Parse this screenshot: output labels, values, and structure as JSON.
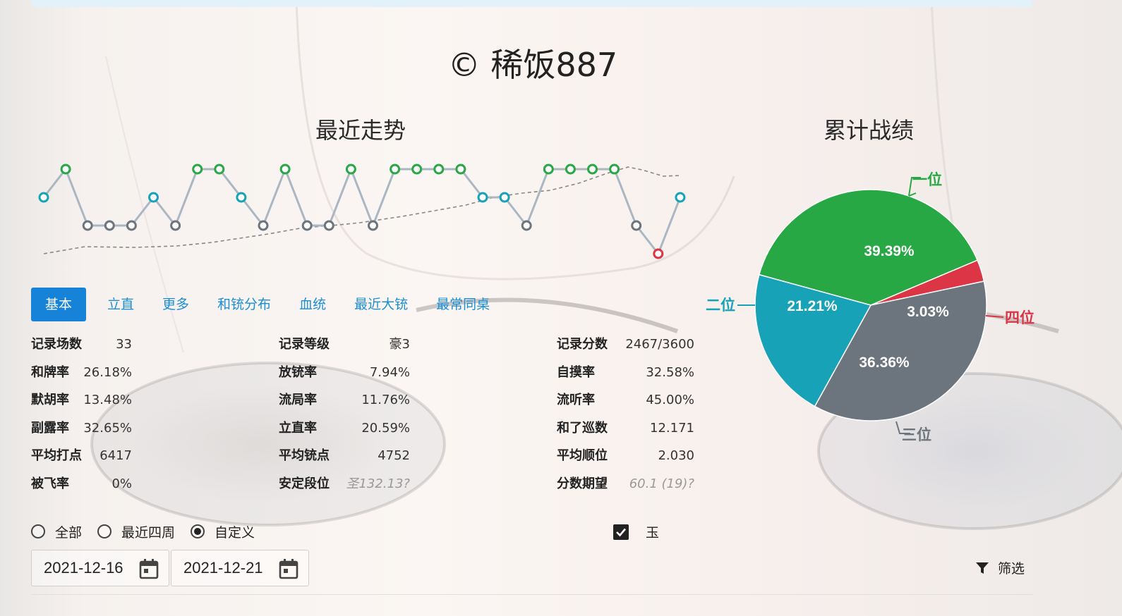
{
  "header": {
    "title": "© 稀饭887"
  },
  "trend": {
    "title": "最近走势",
    "legend_colors": {
      "1": "#28a745",
      "2": "#17a2b8",
      "3": "#6c757d",
      "4": "#dc3545"
    }
  },
  "pie": {
    "title": "累计战绩",
    "slices": [
      {
        "label": "一位",
        "percent": "39.39%",
        "value": 39.39,
        "color": "#28a745"
      },
      {
        "label": "四位",
        "percent": "3.03%",
        "value": 3.03,
        "color": "#dc3545"
      },
      {
        "label": "三位",
        "percent": "36.36%",
        "value": 36.36,
        "color": "#6c757d"
      },
      {
        "label": "二位",
        "percent": "21.21%",
        "value": 21.21,
        "color": "#17a2b8"
      }
    ]
  },
  "tabs": [
    {
      "label": "基本",
      "active": true
    },
    {
      "label": "立直"
    },
    {
      "label": "更多"
    },
    {
      "label": "和铳分布"
    },
    {
      "label": "血统"
    },
    {
      "label": "最近大铳"
    },
    {
      "label": "最常同桌"
    }
  ],
  "stats": {
    "col1": [
      {
        "label": "记录场数",
        "value": "33"
      },
      {
        "label": "和牌率",
        "value": "26.18%"
      },
      {
        "label": "默胡率",
        "value": "13.48%"
      },
      {
        "label": "副露率",
        "value": "32.65%"
      },
      {
        "label": "平均打点",
        "value": "6417"
      },
      {
        "label": "被飞率",
        "value": "0%"
      }
    ],
    "col2": [
      {
        "label": "记录等级",
        "value": "豪3"
      },
      {
        "label": "放铳率",
        "value": "7.94%"
      },
      {
        "label": "流局率",
        "value": "11.76%"
      },
      {
        "label": "立直率",
        "value": "20.59%"
      },
      {
        "label": "平均铳点",
        "value": "4752"
      },
      {
        "label": "安定段位",
        "value": "圣132.13?",
        "muted": true
      }
    ],
    "col3": [
      {
        "label": "记录分数",
        "value": "2467/3600"
      },
      {
        "label": "自摸率",
        "value": "32.58%"
      },
      {
        "label": "流听率",
        "value": "45.00%"
      },
      {
        "label": "和了巡数",
        "value": "12.171"
      },
      {
        "label": "平均顺位",
        "value": "2.030"
      },
      {
        "label": "分数期望",
        "value": "60.1 (19)?",
        "muted": true
      }
    ]
  },
  "filters": {
    "range_options": [
      "全部",
      "最近四周",
      "自定义"
    ],
    "range_selected": "自定义",
    "jade_label": "玉",
    "jade_checked": true,
    "start_date": "2021-12-16",
    "end_date": "2021-12-21",
    "filter_label": "筛选"
  },
  "chart_data": [
    {
      "type": "line",
      "title": "最近走势",
      "x": [
        1,
        2,
        3,
        4,
        5,
        6,
        7,
        8,
        9,
        10,
        11,
        12,
        13,
        14,
        15,
        16,
        17,
        18,
        19,
        20,
        21,
        22,
        23,
        24,
        25,
        26,
        27,
        28,
        29,
        30,
        31
      ],
      "series": [
        {
          "values": [
            2,
            1,
            3,
            3,
            3,
            2,
            3,
            1,
            1,
            2,
            3,
            1,
            3,
            3,
            1,
            3,
            1,
            1,
            1,
            1,
            2,
            2,
            3,
            1,
            1,
            1,
            1,
            3,
            4,
            2
          ]
        }
      ],
      "ylim": [
        1,
        4
      ]
    },
    {
      "type": "pie",
      "title": "累计战绩",
      "categories": [
        "一位",
        "二位",
        "三位",
        "四位"
      ],
      "values": [
        39.39,
        21.21,
        36.36,
        3.03
      ]
    }
  ]
}
